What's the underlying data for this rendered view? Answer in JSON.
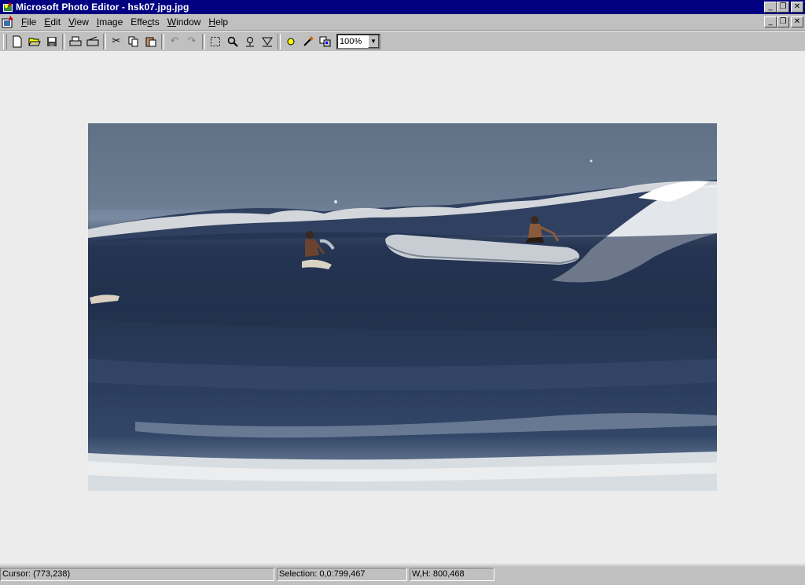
{
  "window": {
    "title": "Microsoft Photo Editor - hsk07.jpg.jpg"
  },
  "menu": {
    "items": [
      {
        "label": "File",
        "accel": "F",
        "rest": "ile"
      },
      {
        "label": "Edit",
        "accel": "E",
        "rest": "dit"
      },
      {
        "label": "View",
        "accel": "V",
        "rest": "iew"
      },
      {
        "label": "Image",
        "accel": "I",
        "rest": "mage"
      },
      {
        "label": "Effects",
        "pre": "Effe",
        "accel": "c",
        "rest": "ts"
      },
      {
        "label": "Window",
        "accel": "W",
        "rest": "indow"
      },
      {
        "label": "Help",
        "accel": "H",
        "rest": "elp"
      }
    ]
  },
  "toolbar": {
    "buttons": [
      "new-icon",
      "open-icon",
      "save-icon",
      "print-icon",
      "scan-icon",
      "cut-icon",
      "copy-icon",
      "paste-icon",
      "undo-icon",
      "redo-icon",
      "select-icon",
      "zoom-icon",
      "smudge-icon",
      "sharpen-icon",
      "balance-icon",
      "eyedropper-icon",
      "effects-icon"
    ],
    "zoom_value": "100%"
  },
  "image": {
    "description_icon": "photo-surfers",
    "colors": {
      "sky": "#6b7b90",
      "sea": "#2a3c5c",
      "foam": "#e4e6e8"
    }
  },
  "status": {
    "cursor": "Cursor: (773,238)",
    "selection": "Selection: 0,0:799,467",
    "size": "W,H: 800,468"
  }
}
